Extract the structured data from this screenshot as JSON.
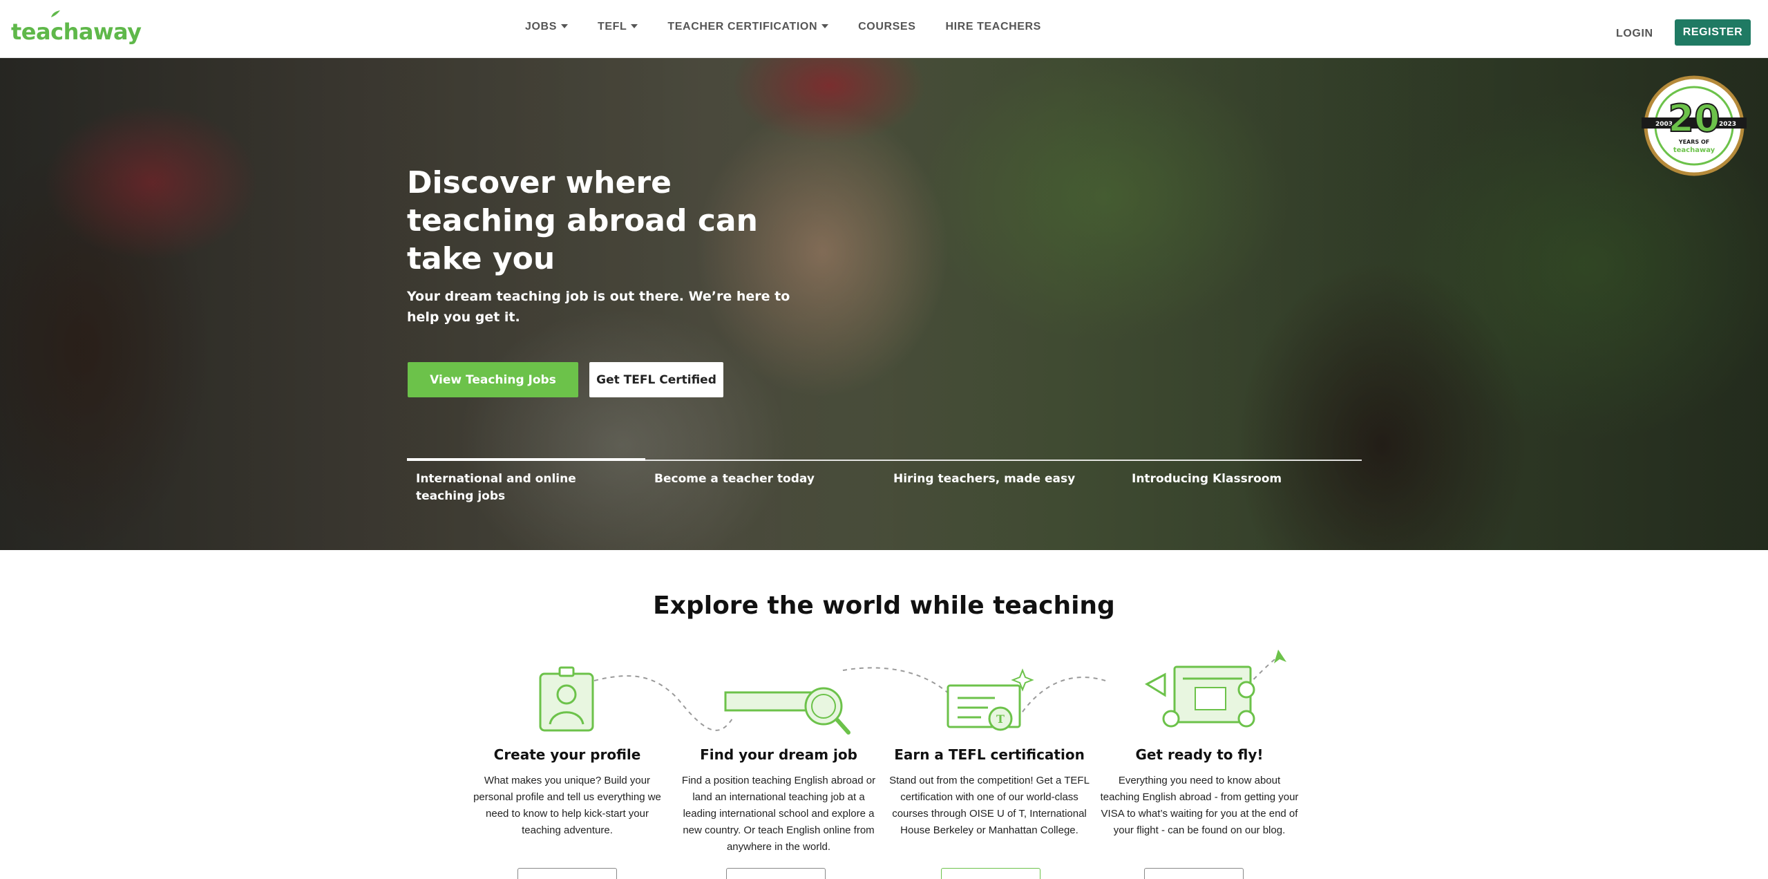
{
  "header": {
    "logo_text": "teachaway",
    "nav": [
      {
        "label": "JOBS",
        "dropdown": true
      },
      {
        "label": "TEFL",
        "dropdown": true
      },
      {
        "label": "TEACHER CERTIFICATION",
        "dropdown": true
      },
      {
        "label": "COURSES",
        "dropdown": false
      },
      {
        "label": "HIRE TEACHERS",
        "dropdown": false
      }
    ],
    "login_label": "LOGIN",
    "register_label": "REGISTER"
  },
  "hero": {
    "title": "Discover where teaching abroad can take you",
    "subtitle": "Your dream teaching job is out there. We’re here to help you get it.",
    "primary_button": "View Teaching Jobs",
    "secondary_button": "Get TEFL Certified",
    "slides": [
      {
        "label": "International and online teaching jobs",
        "active": true
      },
      {
        "label": "Become a teacher today",
        "active": false
      },
      {
        "label": "Hiring teachers, made easy",
        "active": false
      },
      {
        "label": "Introducing Klassroom",
        "active": false
      }
    ],
    "badge": {
      "number": "20",
      "years_text": "YEARS OF",
      "brand": "teachaway",
      "year_start": "2003",
      "year_end": "2023"
    }
  },
  "explore": {
    "title": "Explore the world while teaching",
    "steps": [
      {
        "title": "Create your profile",
        "description": "What makes you unique? Build your personal profile and tell us everything we need to know to help kick-start your teaching adventure."
      },
      {
        "title": "Find your dream job",
        "description": "Find a position teaching English abroad or land an international teaching job at a leading international school and explore a new country. Or teach English online from anywhere in the world."
      },
      {
        "title": "Earn a TEFL certification",
        "description": "Stand out from the competition! Get a TEFL certification with one of our world-class courses through OISE U of T, International House Berkeley or Manhattan College."
      },
      {
        "title": "Get ready to fly!",
        "description": "Everything you need to know about teaching English abroad - from getting your VISA to what’s waiting for you at the end of your flight - can be found on our blog."
      }
    ]
  },
  "colors": {
    "brand_green": "#6cc24a",
    "register_teal": "#1f7a63",
    "logo_green": "#5fb84a"
  }
}
